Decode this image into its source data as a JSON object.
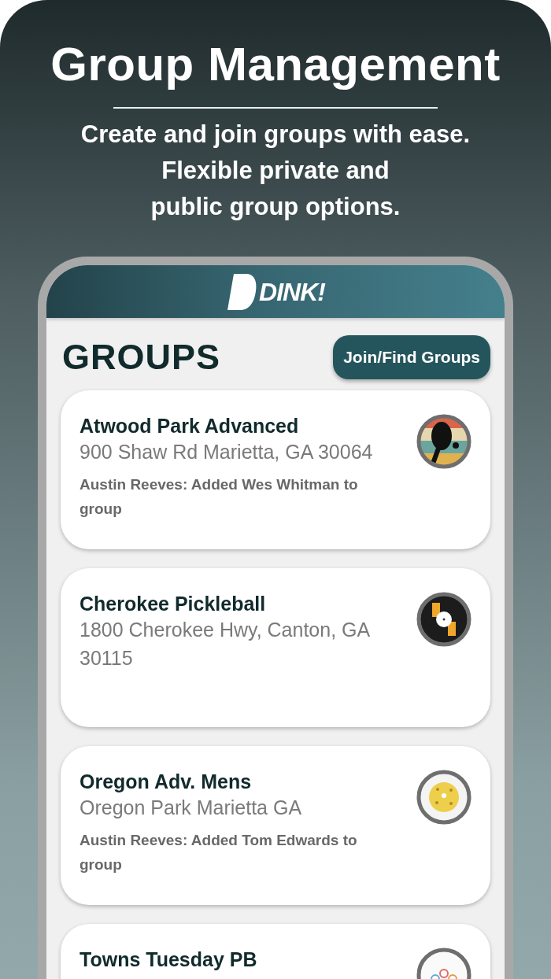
{
  "headline": "Group Management",
  "subtitle_lines": [
    "Create and join groups with ease.",
    "Flexible private and",
    "public group options."
  ],
  "app": {
    "logo": "DINK!",
    "title": "GROUPS",
    "action_button": "Join/Find Groups",
    "groups": [
      {
        "name": "Atwood Park Advanced",
        "address": "900 Shaw Rd Marietta, GA 30064",
        "activity": "Austin Reeves: Added Wes Whitman to group",
        "avatar": {
          "kind": "paddle"
        }
      },
      {
        "name": "Cherokee Pickleball",
        "address": "1800 Cherokee Hwy, Canton, GA 30115",
        "avatar": {
          "kind": "dark-ball"
        }
      },
      {
        "name": "Oregon Adv. Mens",
        "address": "Oregon Park Marietta GA",
        "activity": "Austin Reeves: Added Tom Edwards to group",
        "avatar": {
          "kind": "ball"
        }
      },
      {
        "name": "Towns Tuesday PB",
        "avatar": {
          "kind": "people"
        }
      }
    ]
  }
}
